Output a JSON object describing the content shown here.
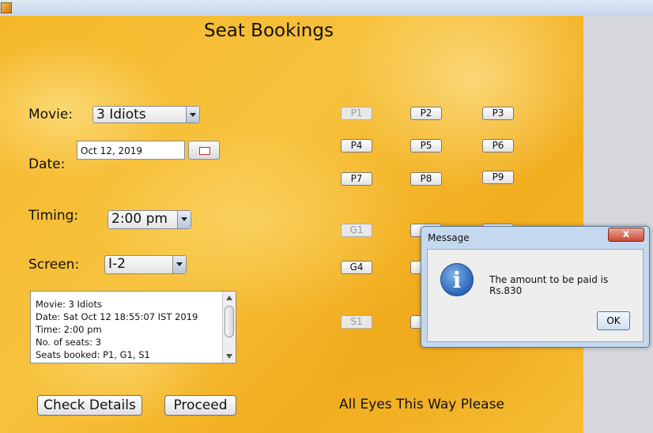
{
  "window": {
    "icon": "java-app-icon"
  },
  "page": {
    "title": "Seat Bookings"
  },
  "form": {
    "movie_label": "Movie:",
    "movie_value": "3 Idiots",
    "date_label": "Date:",
    "date_value": "Oct 12, 2019",
    "timing_label": "Timing:",
    "timing_value": "2:00 pm",
    "screen_label": "Screen:",
    "screen_value": "I-2"
  },
  "seats": {
    "p1": "P1",
    "p2": "P2",
    "p3": "P3",
    "p4": "P4",
    "p5": "P5",
    "p6": "P6",
    "p7": "P7",
    "p8": "P8",
    "p9": "P9",
    "g1": "G1",
    "g4": "G4",
    "s1": "S1"
  },
  "summary": {
    "lines": [
      "Movie: 3 Idiots",
      "Date: Sat Oct 12 18:55:07 IST 2019",
      "Time: 2:00 pm",
      "No. of seats: 3",
      "Seats booked: P1, G1, S1"
    ]
  },
  "buttons": {
    "check_details": "Check Details",
    "proceed": "Proceed"
  },
  "footer": {
    "text": "All Eyes This Way Please"
  },
  "dialog": {
    "title": "Message",
    "close_glyph": "x",
    "icon": "info-icon",
    "icon_glyph": "i",
    "message": "The amount to be paid is Rs.830",
    "ok_label": "OK"
  }
}
